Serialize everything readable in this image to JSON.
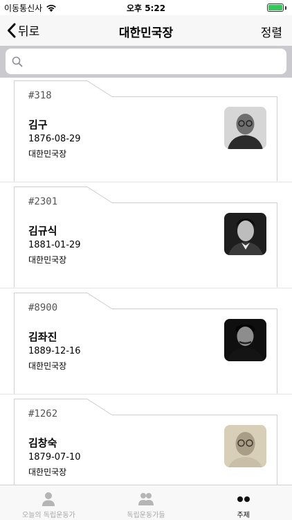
{
  "status_bar": {
    "carrier": "이동통신사",
    "time": "오후 5:22"
  },
  "nav": {
    "back_label": "뒤로",
    "title": "대한민국장",
    "action_label": "정렬"
  },
  "search": {
    "placeholder": ""
  },
  "cards": [
    {
      "number": "#318",
      "name": "김구",
      "birth_date": "1876-08-29",
      "award": "대한민국장"
    },
    {
      "number": "#2301",
      "name": "김규식",
      "birth_date": "1881-01-29",
      "award": "대한민국장"
    },
    {
      "number": "#8900",
      "name": "김좌진",
      "birth_date": "1889-12-16",
      "award": "대한민국장"
    },
    {
      "number": "#1262",
      "name": "김창숙",
      "birth_date": "1879-07-10",
      "award": "대한민국장"
    }
  ],
  "tabs": [
    {
      "label": "오늘의 독립운동가",
      "icon": "person-icon",
      "active": false
    },
    {
      "label": "독립운동가들",
      "icon": "people-icon",
      "active": false
    },
    {
      "label": "주제",
      "icon": "dots-icon",
      "active": true
    }
  ],
  "colors": {
    "battery": "#34c759",
    "tab_inactive": "#a7a7a7",
    "search_bar": "#c9c9ce"
  }
}
